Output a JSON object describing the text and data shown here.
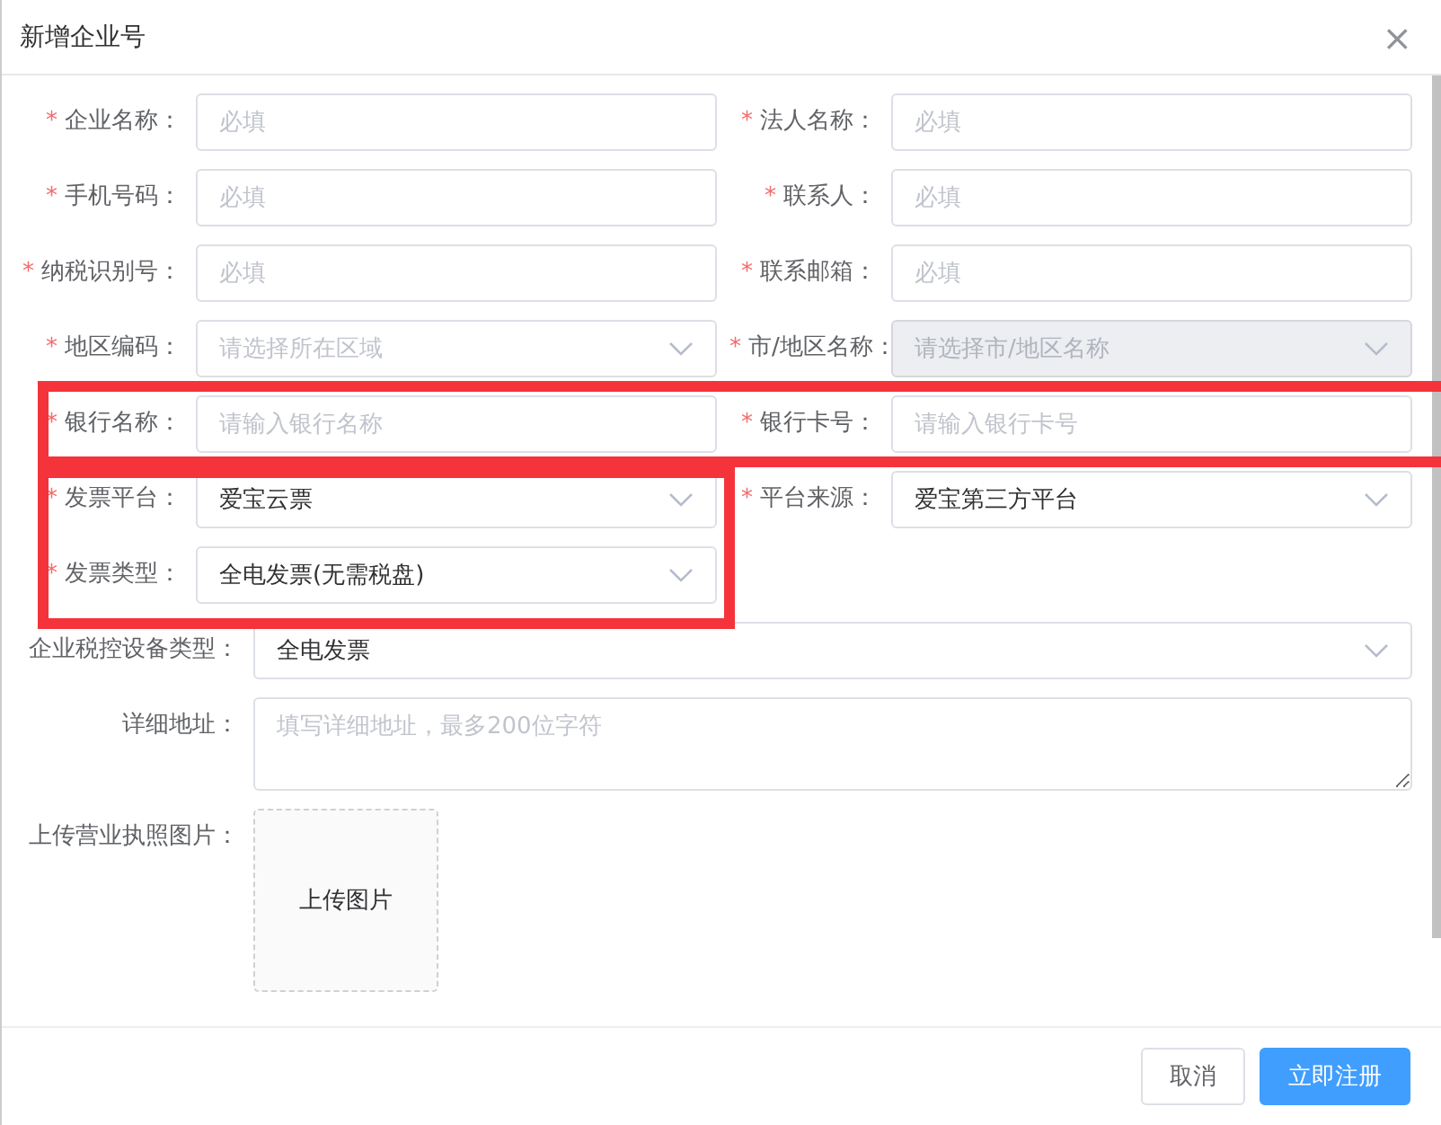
{
  "dialog": {
    "title": "新增企业号",
    "close": "×"
  },
  "sections": [
    {
      "highlighted": false,
      "kind": "two-column",
      "columns": [
        {
          "highlighted": false,
          "fields": [
            {
              "label": "企业名称：",
              "required_mark": "*",
              "kind": "input",
              "placeholder": "必填",
              "disabled": false
            },
            {
              "label": "手机号码：",
              "required_mark": "*",
              "kind": "input",
              "placeholder": "必填",
              "disabled": false
            },
            {
              "label": "纳税识别号：",
              "required_mark": "*",
              "kind": "input",
              "placeholder": "必填",
              "disabled": false
            },
            {
              "label": "地区编码：",
              "required_mark": "*",
              "kind": "select",
              "placeholder": "请选择所在区域",
              "disabled": false
            }
          ]
        },
        {
          "highlighted": false,
          "fields": [
            {
              "label": "法人名称：",
              "required_mark": "*",
              "kind": "input",
              "placeholder": "必填",
              "disabled": false
            },
            {
              "label": "联系人：",
              "required_mark": "*",
              "kind": "input",
              "placeholder": "必填",
              "disabled": false
            },
            {
              "label": "联系邮箱：",
              "required_mark": "*",
              "kind": "input",
              "placeholder": "必填",
              "disabled": false
            },
            {
              "label": "市/地区名称：",
              "required_mark": "*",
              "kind": "select",
              "placeholder": "请选择市/地区名称",
              "disabled": true
            }
          ]
        }
      ]
    },
    {
      "highlighted": true,
      "kind": "two-column",
      "columns": [
        {
          "highlighted": false,
          "fields": [
            {
              "label": "银行名称：",
              "required_mark": "*",
              "kind": "input",
              "placeholder": "请输入银行名称",
              "disabled": false
            }
          ]
        },
        {
          "highlighted": false,
          "fields": [
            {
              "label": "银行卡号：",
              "required_mark": "*",
              "kind": "input",
              "placeholder": "请输入银行卡号",
              "disabled": false
            }
          ]
        }
      ]
    },
    {
      "highlighted": false,
      "kind": "two-column",
      "columns": [
        {
          "highlighted": true,
          "fields": [
            {
              "label": "发票平台：",
              "required_mark": "*",
              "kind": "select",
              "value": "爱宝云票",
              "disabled": false
            },
            {
              "label": "发票类型：",
              "required_mark": "*",
              "kind": "select",
              "value": "全电发票(无需税盘)",
              "disabled": false
            }
          ]
        },
        {
          "highlighted": false,
          "fields": [
            {
              "label": "平台来源：",
              "required_mark": "*",
              "kind": "select",
              "value": "爱宝第三方平台",
              "disabled": false
            }
          ]
        }
      ]
    },
    {
      "highlighted": false,
      "kind": "wide",
      "columns": [
        {
          "highlighted": false,
          "fields": [
            {
              "label": "企业税控设备类型：",
              "kind": "select",
              "value": "全电发票",
              "disabled": false
            },
            {
              "label": "详细地址：",
              "kind": "textarea",
              "placeholder": "填写详细地址，最多200位字符"
            },
            {
              "label": "上传营业执照图片：",
              "kind": "upload",
              "value": "上传图片"
            }
          ]
        }
      ]
    }
  ],
  "buttons": [
    {
      "label": "取消",
      "kind": "default"
    },
    {
      "label": "立即注册",
      "kind": "primary"
    }
  ]
}
